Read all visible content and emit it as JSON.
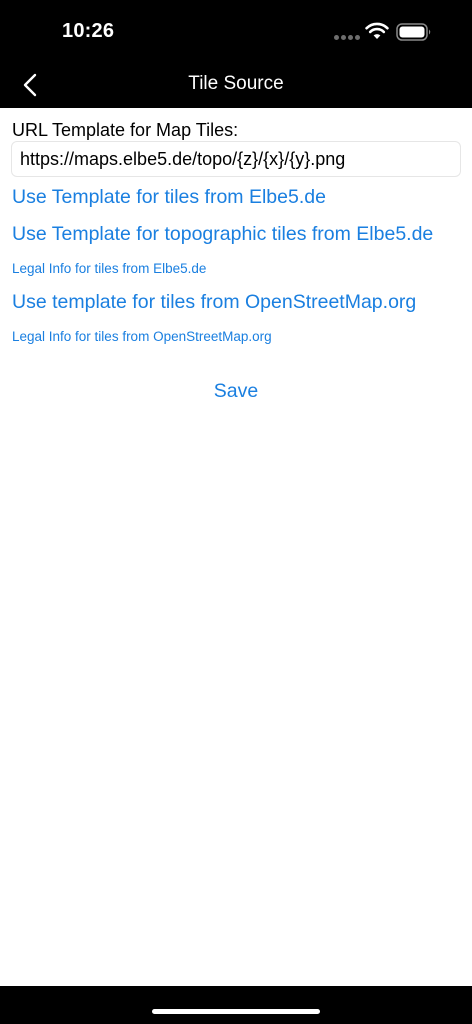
{
  "status_bar": {
    "time": "10:26"
  },
  "nav": {
    "title": "Tile Source",
    "back_icon": "chevron-left-icon"
  },
  "form": {
    "url_label": "URL Template for Map Tiles:",
    "url_value": "https://maps.elbe5.de/topo/{z}/{x}/{y}.png"
  },
  "links": {
    "elbe5_template": "Use Template for tiles from Elbe5.de",
    "elbe5_topo_template": "Use Template for topographic tiles from Elbe5.de",
    "elbe5_legal": "Legal Info for tiles from Elbe5.de",
    "osm_template": "Use template for tiles from OpenStreetMap.org",
    "osm_legal": "Legal Info for tiles from OpenStreetMap.org"
  },
  "save_label": "Save",
  "colors": {
    "accent": "#1a7fe0",
    "bar_background": "#000000",
    "content_background": "#ffffff"
  }
}
